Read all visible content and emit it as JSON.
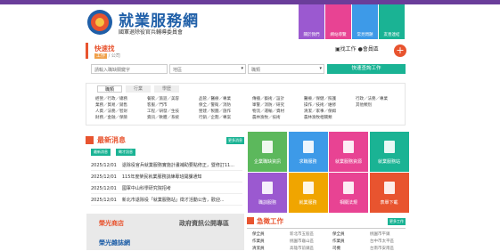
{
  "header": {
    "title": "就業服務網",
    "subtitle": "國軍退除役官兵輔導委員會",
    "nav": [
      {
        "label": "關於我們",
        "color": "#9b59d0"
      },
      {
        "label": "網站導覽",
        "color": "#e84393"
      },
      {
        "label": "常見問題",
        "color": "#3d9ae8"
      },
      {
        "label": "友善連結",
        "color": "#1ab394"
      }
    ]
  },
  "search": {
    "title": "快速找",
    "crumb_active": "工作",
    "crumb_rest": "/ 公司",
    "find_job": "找工作",
    "resume": "會員區",
    "keyword_placeholder": "請輸入職缺關鍵字",
    "region": "地區",
    "category": "職類",
    "button": "快速查詢工作"
  },
  "category_tabs": [
    "職類",
    "行業",
    "學歷"
  ],
  "categories": [
    [
      "經營／行政／總務",
      "業務／貿易／銷售",
      "人資／法務／智財",
      "財務／金融／保險"
    ],
    [
      "餐飲／旅遊／美容",
      "客服／門市",
      "工程／研發／生技",
      "資訊／軟體／系統"
    ],
    [
      "品管／醫療／專業",
      "保全／警衛／消防",
      "營建／製圖／施作",
      "行銷／企劃／專案"
    ],
    [
      "傳播／藝術／設計",
      "軍警／消防／研究",
      "物流／運輸／資材",
      "農林漁牧／技術"
    ],
    [
      "醫療／保健／照護",
      "操作／技術／維修",
      "清潔／家事／保姆",
      "農林漁牧相關類"
    ],
    [
      "行政／法務／專業",
      "其他類別"
    ]
  ],
  "news": {
    "title": "最新消息",
    "more": "更多消息",
    "tabs": [
      "最新消息",
      "徵才訊息"
    ],
    "items": [
      {
        "date": "2025/12/01",
        "text": "退除役官兵就業服務實施計畫補助要點修正，暨修訂11..."
      },
      {
        "date": "2025/12/01",
        "text": "115年度榮民就業服務訓練專班開課通知"
      },
      {
        "date": "2025/12/01",
        "text": "國軍中山科學研究院招考"
      },
      {
        "date": "2025/12/01",
        "text": "新北市退除役「就業服務站」徵才活動公告，歡迎..."
      }
    ]
  },
  "tiles": [
    {
      "label": "企業職缺資訊",
      "color": "#5cb85c"
    },
    {
      "label": "求職服務",
      "color": "#3d9ae8"
    },
    {
      "label": "就業服務資源",
      "color": "#e84393"
    },
    {
      "label": "就業服務站",
      "color": "#1ab394"
    },
    {
      "label": "職訓服務",
      "color": "#9b59d0"
    },
    {
      "label": "就業服務",
      "color": "#f0a500"
    },
    {
      "label": "相關法規",
      "color": "#e84393"
    },
    {
      "label": "表單下載",
      "color": "#e8542f"
    }
  ],
  "ads": {
    "store": "榮光商店",
    "news": "政府資訊公開專區",
    "bottom": "榮光雜誌網"
  },
  "jobs": {
    "title": "急徵工作",
    "more": "更多工作",
    "rows": [
      [
        "保全員",
        "新北市五股區",
        "保全員",
        "桃園市平鎮"
      ],
      [
        "作業員",
        "桃園市龜山區",
        "作業員",
        "台中市太平區"
      ],
      [
        "清潔員",
        "高雄市前鎮區",
        "司機",
        "台南市安南區"
      ]
    ]
  }
}
